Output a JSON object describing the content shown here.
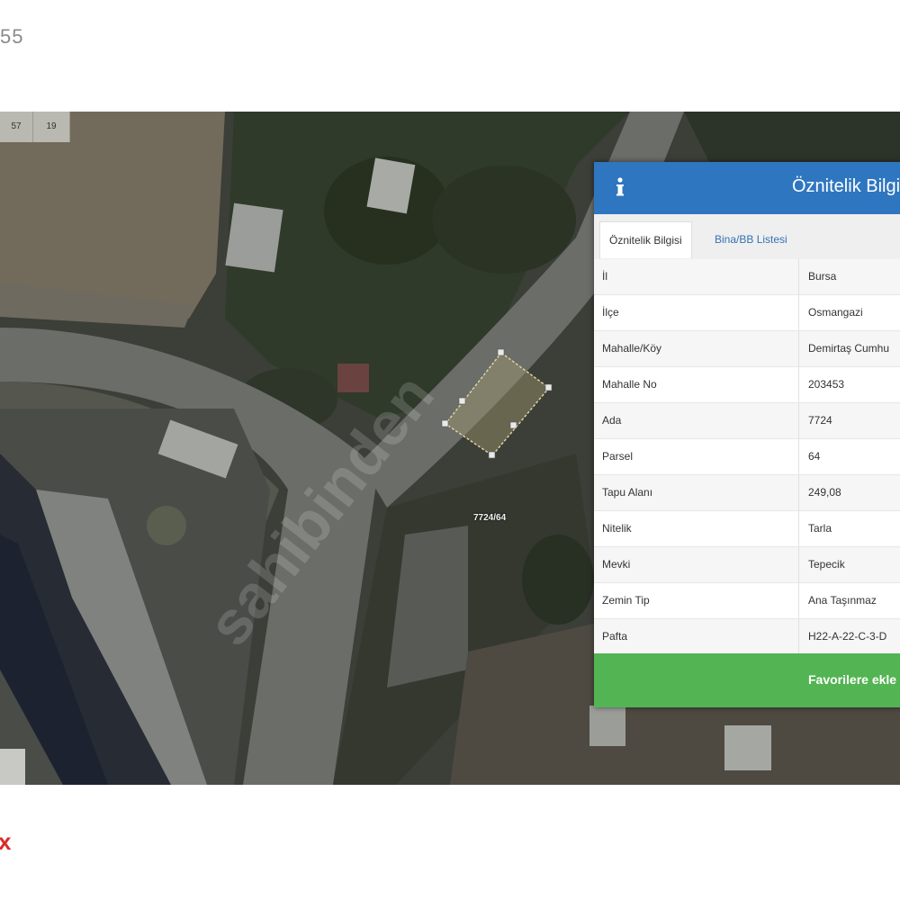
{
  "page": {
    "top_number": "55",
    "bottom_mark": "x"
  },
  "map": {
    "zoom_cells": [
      "57",
      "19"
    ],
    "parcel_label": "7724/64",
    "watermark": "sahibinden"
  },
  "panel": {
    "title": "Öznitelik Bilgi",
    "tabs": [
      {
        "label": "Öznitelik Bilgisi",
        "active": true
      },
      {
        "label": "Bina/BB Listesi",
        "active": false
      }
    ],
    "rows": [
      {
        "key": "İl",
        "value": "Bursa"
      },
      {
        "key": "İlçe",
        "value": "Osmangazi"
      },
      {
        "key": "Mahalle/Köy",
        "value": "Demirtaş Cumhu"
      },
      {
        "key": "Mahalle No",
        "value": "203453"
      },
      {
        "key": "Ada",
        "value": "7724"
      },
      {
        "key": "Parsel",
        "value": "64"
      },
      {
        "key": "Tapu Alanı",
        "value": "249,08"
      },
      {
        "key": "Nitelik",
        "value": "Tarla"
      },
      {
        "key": "Mevki",
        "value": "Tepecik"
      },
      {
        "key": "Zemin Tip",
        "value": "Ana Taşınmaz"
      },
      {
        "key": "Pafta",
        "value": "H22-A-22-C-3-D"
      }
    ],
    "favorite_button": "Favorilere ekle"
  },
  "colors": {
    "header": "#2f76c0",
    "button": "#52b452",
    "tab_link": "#3571b5"
  }
}
